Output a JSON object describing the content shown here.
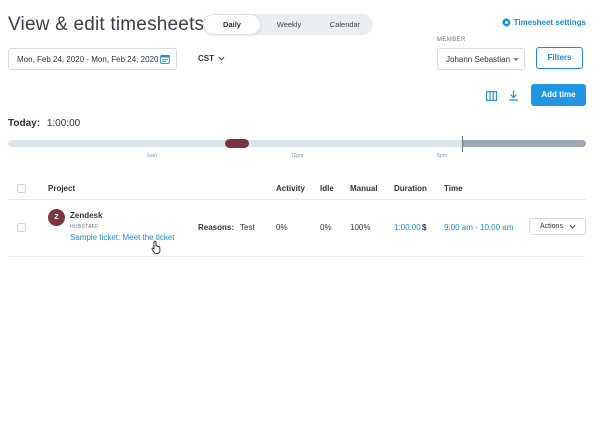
{
  "header": {
    "title": "View & edit timesheets",
    "settings_label": "Timesheet settings"
  },
  "view_tabs": [
    {
      "label": "Daily",
      "active": true
    },
    {
      "label": "Weekly",
      "active": false
    },
    {
      "label": "Calendar",
      "active": false
    }
  ],
  "filters": {
    "date_range": "Mon, Feb 24, 2020 - Mon, Feb 24, 2020",
    "timezone": "CST",
    "member_label": "MEMBER",
    "member_value": "Johann Sebastian",
    "filters_label": "Filters",
    "add_time_label": "Add time"
  },
  "today": {
    "label": "Today:",
    "value": "1:00:00"
  },
  "timeline": {
    "ticks": [
      "6am",
      "12pm",
      "6pm"
    ]
  },
  "table": {
    "headers": {
      "project": "Project",
      "activity": "Activity",
      "idle": "Idle",
      "manual": "Manual",
      "duration": "Duration",
      "time": "Time"
    },
    "rows": [
      {
        "avatar_letter": "Z",
        "project": "Zendesk",
        "organization": "HUBSTAFF",
        "task": "Sample ticket: Meet the ticket",
        "reasons_label": "Reasons:",
        "reason": "Test",
        "activity": "0%",
        "idle": "0%",
        "manual": "100%",
        "duration": "1:00:00",
        "billable_symbol": "$",
        "time_range": "9:00 am - 10:00 am",
        "actions_label": "Actions"
      }
    ]
  },
  "colors": {
    "accent": "#2196e3",
    "link": "#1f8ad6",
    "entry": "#7a3540",
    "track": "#dde3ea",
    "track_future": "#9fa9b5"
  },
  "icons": {
    "settings": "gear-icon",
    "date": "calendar-icon",
    "columns": "columns-icon",
    "download": "download-icon",
    "cursor": "hand-pointer-icon"
  }
}
